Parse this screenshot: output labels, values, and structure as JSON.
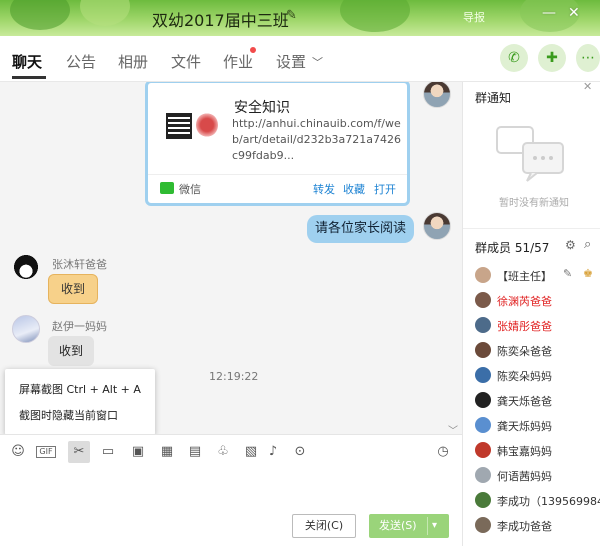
{
  "window": {
    "title": "双幼2017届中三班",
    "sound_label": "导报"
  },
  "tabs": [
    {
      "label": "聊天",
      "active": true
    },
    {
      "label": "公告"
    },
    {
      "label": "相册"
    },
    {
      "label": "文件"
    },
    {
      "label": "作业",
      "badge": true
    },
    {
      "label": "设置"
    }
  ],
  "chat": {
    "share_card": {
      "title": "安全知识",
      "url": "http://anhui.chinauib.com/f/web/art/detail/d232b3a721a7426c99fdab9...",
      "source": "微信",
      "actions": [
        "转发",
        "收藏",
        "打开"
      ]
    },
    "messages": [
      {
        "sender": "",
        "text": "请各位家长阅读"
      },
      {
        "sender": "张沐轩爸爸",
        "text": "收到"
      },
      {
        "sender": "赵伊一妈妈",
        "text": "收到"
      }
    ],
    "timestamp": "12:19:22"
  },
  "context_menu": {
    "items": [
      "屏幕截图 Ctrl + Alt + A",
      "截图时隐藏当前窗口"
    ]
  },
  "input": {
    "close_label": "关闭(C)",
    "send_label": "发送(S)"
  },
  "group_notice": {
    "title": "群通知",
    "empty_text": "暂时没有新通知"
  },
  "members": {
    "title": "群成员 51/57",
    "list": [
      {
        "name": "【班主任】",
        "red": false
      },
      {
        "name": "徐渊芮爸爸",
        "red": true
      },
      {
        "name": "张婧彤爸爸",
        "red": true
      },
      {
        "name": "陈奕朵爸爸",
        "red": false
      },
      {
        "name": "陈奕朵妈妈",
        "red": false
      },
      {
        "name": "龚天烁爸爸",
        "red": false
      },
      {
        "name": "龚天烁妈妈",
        "red": false
      },
      {
        "name": "韩宝嘉妈妈",
        "red": false
      },
      {
        "name": "何语茜妈妈",
        "red": false
      },
      {
        "name": "李成功（1395699845",
        "red": false
      },
      {
        "name": "李成功爸爸",
        "red": false
      }
    ]
  },
  "colors": {
    "accent_green": "#9ad47a",
    "bubble_blue": "#9fd0ef",
    "link_blue": "#1d83d3",
    "member_red": "#e02020"
  }
}
